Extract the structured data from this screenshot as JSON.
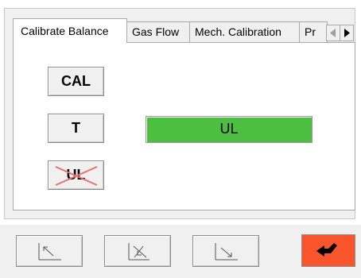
{
  "tabs": [
    {
      "label": "Calibrate Balance",
      "active": true
    },
    {
      "label": "Gas Flow",
      "active": false
    },
    {
      "label": "Mech. Calibration",
      "active": false
    },
    {
      "label": "Pr",
      "active": false
    }
  ],
  "buttons": {
    "cal_label": "CAL",
    "t_label": "T",
    "ul_label": "UL"
  },
  "status": {
    "value": "UL",
    "color": "#4cbf40"
  },
  "bottom_nav": {
    "icons": [
      "arrow-up-left-icon",
      "arrow-upleft-crossed-icon",
      "arrow-down-right-icon",
      "enter-return-icon"
    ],
    "enter_color": "#f8552c"
  }
}
